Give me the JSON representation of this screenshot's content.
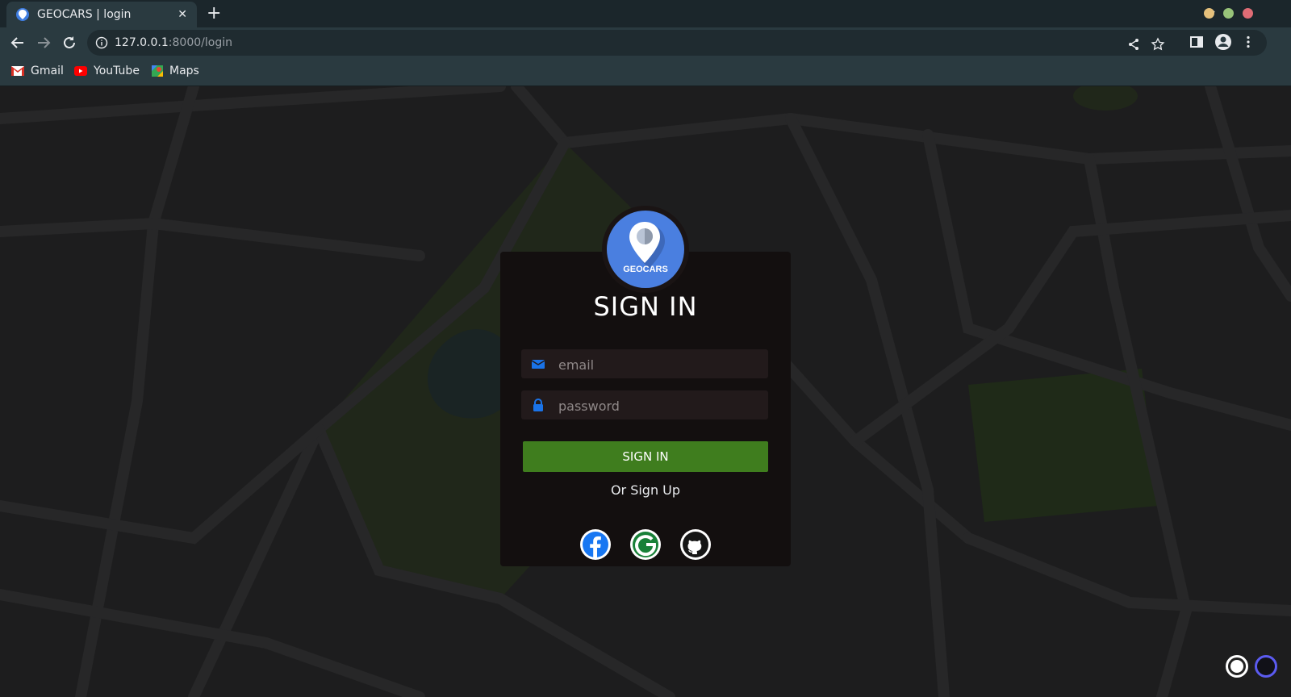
{
  "browser": {
    "tab": {
      "title": "GEOCARS | login",
      "favicon": "geocars-pin-icon"
    },
    "address": {
      "host": "127.0.0.1",
      "path": ":8000/login"
    },
    "bookmarks": [
      {
        "label": "Gmail",
        "icon": "gmail-icon"
      },
      {
        "label": "YouTube",
        "icon": "youtube-icon"
      },
      {
        "label": "Maps",
        "icon": "maps-icon"
      }
    ],
    "window_dots": [
      "#e5c07b",
      "#98c379",
      "#e06c75"
    ]
  },
  "login": {
    "logo_text": "GEOCARS",
    "title": "SIGN IN",
    "email_placeholder": "email",
    "password_placeholder": "password",
    "submit_label": "SIGN IN",
    "alt_text": "Or Sign Up",
    "social": [
      "facebook-icon",
      "google-icon",
      "github-icon"
    ]
  },
  "colors": {
    "accent_blue": "#4a7fe0",
    "button_green": "#3f7d1e",
    "card_bg": "#130f0f"
  }
}
